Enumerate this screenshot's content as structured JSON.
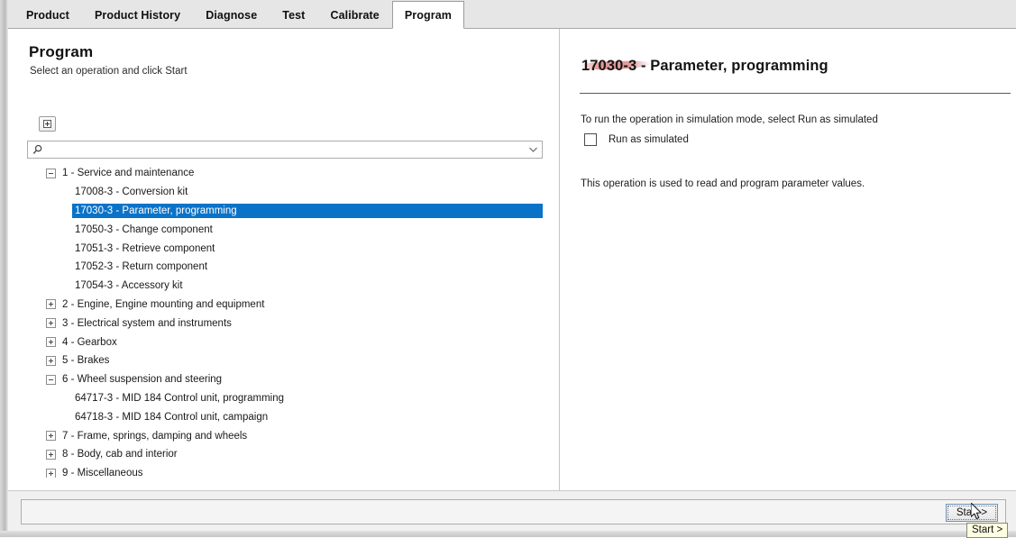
{
  "tabs": [
    {
      "label": "Product",
      "active": false
    },
    {
      "label": "Product History",
      "active": false
    },
    {
      "label": "Diagnose",
      "active": false
    },
    {
      "label": "Test",
      "active": false
    },
    {
      "label": "Calibrate",
      "active": false
    },
    {
      "label": "Program",
      "active": true
    }
  ],
  "left": {
    "title": "Program",
    "subtitle": "Select an operation and click Start",
    "expand_all_icon": "box-plus-icon",
    "search": {
      "value": "",
      "placeholder": "",
      "icon": "search-icon",
      "dropdown_icon": "chevron-down-icon"
    },
    "tree": [
      {
        "level": "group",
        "expander": "minus",
        "label": "1 - Service and maintenance",
        "selected": false
      },
      {
        "level": "leaf",
        "expander": "none",
        "label": "17008-3 - Conversion kit",
        "selected": false
      },
      {
        "level": "leaf",
        "expander": "none",
        "label": "17030-3 - Parameter, programming",
        "selected": true
      },
      {
        "level": "leaf",
        "expander": "none",
        "label": "17050-3 - Change component",
        "selected": false
      },
      {
        "level": "leaf",
        "expander": "none",
        "label": "17051-3 - Retrieve component",
        "selected": false
      },
      {
        "level": "leaf",
        "expander": "none",
        "label": "17052-3 - Return component",
        "selected": false
      },
      {
        "level": "leaf",
        "expander": "none",
        "label": "17054-3 - Accessory kit",
        "selected": false
      },
      {
        "level": "group",
        "expander": "plus",
        "label": "2 - Engine, Engine mounting and equipment",
        "selected": false
      },
      {
        "level": "group",
        "expander": "plus",
        "label": "3 - Electrical system and instruments",
        "selected": false
      },
      {
        "level": "group",
        "expander": "plus",
        "label": "4 - Gearbox",
        "selected": false
      },
      {
        "level": "group",
        "expander": "plus",
        "label": "5 - Brakes",
        "selected": false
      },
      {
        "level": "group",
        "expander": "minus",
        "label": "6 - Wheel suspension and steering",
        "selected": false
      },
      {
        "level": "leaf",
        "expander": "none",
        "label": "64717-3 - MID 184 Control unit, programming",
        "selected": false
      },
      {
        "level": "leaf",
        "expander": "none",
        "label": "64718-3 - MID 184 Control unit, campaign",
        "selected": false
      },
      {
        "level": "group",
        "expander": "plus",
        "label": "7 - Frame, springs, damping and wheels",
        "selected": false
      },
      {
        "level": "group",
        "expander": "plus",
        "label": "8 - Body, cab and interior",
        "selected": false
      },
      {
        "level": "group",
        "expander": "plus",
        "label": "9 - Miscellaneous",
        "selected": false
      }
    ]
  },
  "right": {
    "op_title": "17030-3 - Parameter, programming",
    "hint": "To run the operation in simulation mode, select Run as simulated",
    "simulate_label": "Run as simulated",
    "simulate_checked": false,
    "description": "This operation is used to read and program parameter values."
  },
  "bottom": {
    "start_label": "Start >",
    "tooltip": "Start >"
  },
  "colors": {
    "selection_blue": "#0a73c8",
    "tooltip_yellow": "#ffffe1",
    "annotation_red": "#c44646",
    "tab_active_bg": "#ffffff"
  }
}
